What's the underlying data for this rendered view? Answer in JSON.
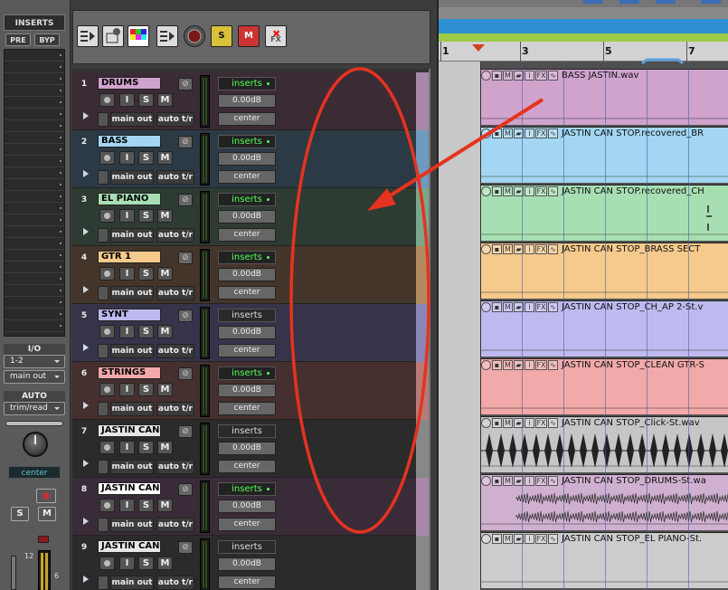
{
  "inserts_panel": {
    "title": "INSERTS",
    "pre_label": "PRE",
    "byp_label": "BYP",
    "io_label": "I/O",
    "input_value": "1-2",
    "output_value": "main out",
    "auto_label": "AUTO",
    "auto_mode": "trim/read",
    "pan_value": "center",
    "solo_label": "S",
    "mute_label": "M",
    "meter_ticks": [
      "12",
      "6"
    ]
  },
  "toolbar": {
    "icons": [
      "midi-track-icon",
      "plugin-icon",
      "color-palette-icon",
      "list-view-icon",
      "record-enable-icon",
      "solo-icon",
      "mute-icon",
      "fx-bypass-icon"
    ],
    "solo_label": "S",
    "mute_label": "M",
    "fx_label": "FX"
  },
  "track_common": {
    "input_label": "I",
    "solo_label": "S",
    "mute_label": "M",
    "output_label": "main out",
    "auto_label": "auto t/r",
    "volume": "0.00dB",
    "pan": "center"
  },
  "tracks": [
    {
      "number": "1",
      "name": "DRUMS",
      "inserts_label": "inserts",
      "inserts_active": true,
      "color": "#cfa3cc",
      "bg": "#3b2b35",
      "trail": "#a888a8"
    },
    {
      "number": "2",
      "name": "BASS",
      "inserts_label": "inserts",
      "inserts_active": true,
      "color": "#a2d6f2",
      "bg": "#2c3a45",
      "trail": "#6e9bbd"
    },
    {
      "number": "3",
      "name": "EL PIANO",
      "inserts_label": "inserts",
      "inserts_active": true,
      "color": "#a7dfb3",
      "bg": "#2e3b32",
      "trail": "#7aa88a"
    },
    {
      "number": "4",
      "name": "GTR 1",
      "inserts_label": "inserts",
      "inserts_active": true,
      "color": "#f6c98c",
      "bg": "#44352a",
      "trail": "#b38b60"
    },
    {
      "number": "5",
      "name": "SYNT",
      "inserts_label": "inserts",
      "inserts_active": false,
      "color": "#bebaf0",
      "bg": "#35344a",
      "trail": "#8a87b8"
    },
    {
      "number": "6",
      "name": "STRINGS",
      "inserts_label": "inserts",
      "inserts_active": true,
      "color": "#f2a9a9",
      "bg": "#45302f",
      "trail": "#b87a78"
    },
    {
      "number": "7",
      "name": "JASTIN CAN S",
      "inserts_label": "inserts",
      "inserts_active": false,
      "color": "#e6e6e6",
      "bg": "#2b2b2b",
      "trail": "#888"
    },
    {
      "number": "8",
      "name": "JASTIN CAN S",
      "inserts_label": "inserts",
      "inserts_active": true,
      "color": "#ffffff",
      "bg": "#3a2b38",
      "trail": "#a888a8"
    },
    {
      "number": "9",
      "name": "JASTIN CAN S",
      "inserts_label": "inserts",
      "inserts_active": false,
      "color": "#e6e6e6",
      "bg": "#2b2b2b",
      "trail": "#888"
    }
  ],
  "ruler": {
    "bars": [
      "1",
      "3",
      "5",
      "7"
    ]
  },
  "clip_header_icons": [
    "i",
    "FX"
  ],
  "clips": [
    {
      "name": "BASS JASTIN.wav",
      "color": "#cfa3cc",
      "wave": "none"
    },
    {
      "name": "JASTIN CAN STOP.recovered_BR",
      "color": "#a2d6f2",
      "wave": "none"
    },
    {
      "name": "JASTIN CAN STOP.recovered_CH",
      "color": "#a7dfb3",
      "wave": "spike"
    },
    {
      "name": "JASTIN CAN STOP_BRASS SECT",
      "color": "#f6c98c",
      "wave": "none"
    },
    {
      "name": "JASTIN CAN STOP_CH_AP 2-St.v",
      "color": "#bebaf0",
      "wave": "none"
    },
    {
      "name": "JASTIN CAN STOP_CLEAN GTR-S",
      "color": "#f2a9a9",
      "wave": "none"
    },
    {
      "name": "JASTIN CAN STOP_Click-St.wav",
      "color": "#c6c6c6",
      "wave": "click"
    },
    {
      "name": "JASTIN CAN STOP_DRUMS-St.wa",
      "color": "#d0b0d0",
      "wave": "drums"
    },
    {
      "name": "JASTIN CAN STOP_EL PIANO-St.",
      "color": "#cccccc",
      "wave": "none"
    }
  ],
  "colors": {
    "annotation": "#e5331f",
    "active_insert": "#55ff55",
    "pan_display": "#5ec7d0"
  }
}
